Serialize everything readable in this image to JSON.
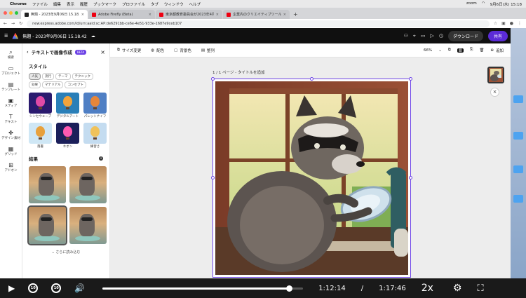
{
  "menubar": {
    "app": "Chrome",
    "items": [
      "ファイル",
      "編集",
      "表示",
      "履歴",
      "ブックマーク",
      "プロファイル",
      "タブ",
      "ウィンドウ",
      "ヘルプ"
    ],
    "right_items": [
      "zoom",
      "9月6日(水) 15:18"
    ]
  },
  "browser": {
    "tabs": [
      {
        "title": "無題 - 2023年9月06日 15.18.42",
        "active": true
      },
      {
        "title": "Adobe Firefly (Beta)",
        "active": false
      },
      {
        "title": "東京都教育委員会が2023年4月1",
        "active": false
      },
      {
        "title": "企業内のクリエイティブツールと",
        "active": false
      }
    ],
    "url": "new.express.adobe.com/id/urn:aaid:sc:AP:de6291bb-ce6e-4e51-933e-1687e9ceb107"
  },
  "app": {
    "doc_title": "無題 - 2023年9月06日 15.18.42",
    "download_label": "ダウンロード",
    "share_label": "共有"
  },
  "rail": {
    "items": [
      {
        "icon": "search-icon",
        "label": "検索"
      },
      {
        "icon": "folder-icon",
        "label": "プロジェクト"
      },
      {
        "icon": "template-icon",
        "label": "テンプレート"
      },
      {
        "icon": "media-icon",
        "label": "メディア"
      },
      {
        "icon": "text-icon",
        "label": "テキスト"
      },
      {
        "icon": "design-icon",
        "label": "デザイン素材"
      },
      {
        "icon": "grid-icon",
        "label": "グリッド"
      },
      {
        "icon": "addon-icon",
        "label": "アドオン"
      }
    ]
  },
  "panel": {
    "title": "テキストで画像作成",
    "beta": "BETA",
    "style_section": "スタイル",
    "chips": [
      "人気",
      "流行",
      "テーマ",
      "テクニック",
      "効果",
      "マテリアル",
      "コンセプト"
    ],
    "styles": [
      {
        "label": "シンセウェーブ",
        "colors": [
          "#e04aa5",
          "#2a1a6e"
        ]
      },
      {
        "label": "デジタルアート",
        "colors": [
          "#f2a33a",
          "#2a7fb8"
        ]
      },
      {
        "label": "パレットナイフ",
        "colors": [
          "#e6863a",
          "#4f7fc4"
        ]
      },
      {
        "label": "落書",
        "colors": [
          "#e8a13c",
          "#cfe7f5"
        ]
      },
      {
        "label": "ネオン",
        "colors": [
          "#ff5ab0",
          "#1b1f5a"
        ]
      },
      {
        "label": "練習さ",
        "colors": [
          "#f0c25a",
          "#c4dcf0"
        ]
      }
    ],
    "results_section": "結果",
    "load_more": "さらに読み込む"
  },
  "toolbar": {
    "resize": "サイズ変更",
    "color": "配色",
    "background": "背景色",
    "arrange": "整列",
    "zoom": "66%",
    "add": "追加"
  },
  "canvas": {
    "page_label": "1 / 1 ページ - タイトルを追加"
  },
  "player": {
    "current_time": "1:12:14",
    "separator": "/",
    "total_time": "1:17:46",
    "speed": "2x",
    "progress": 0.928,
    "skip_back": "10",
    "skip_forward": "10"
  }
}
